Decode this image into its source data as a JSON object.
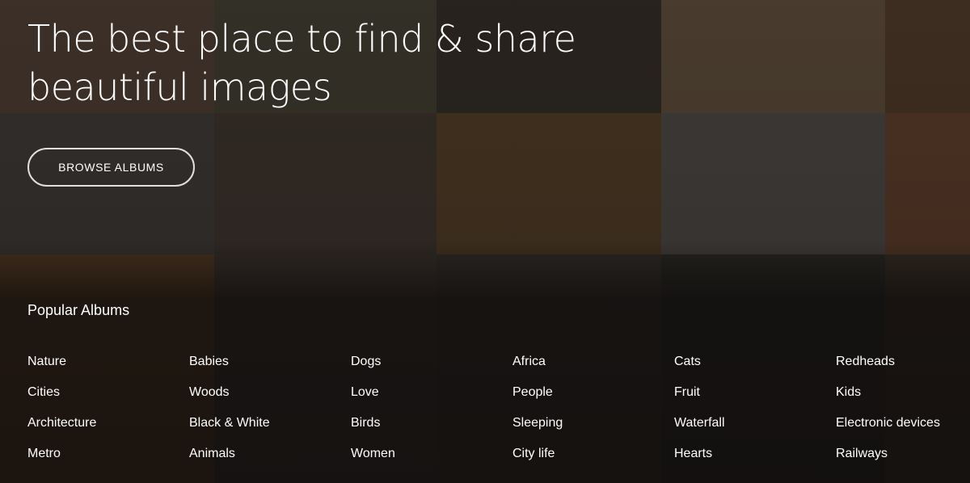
{
  "hero": {
    "headline_line1": "The best place to find & share",
    "headline_line2": "beautiful images",
    "browse_button_label": "BROWSE ALBUMS"
  },
  "popular": {
    "title": "Popular Albums",
    "columns": [
      [
        "Nature",
        "Cities",
        "Architecture",
        "Metro"
      ],
      [
        "Babies",
        "Woods",
        "Black & White",
        "Animals"
      ],
      [
        "Dogs",
        "Love",
        "Birds",
        "Women"
      ],
      [
        "Africa",
        "People",
        "Sleeping",
        "City life"
      ],
      [
        "Cats",
        "Fruit",
        "Waterfall",
        "Hearts"
      ],
      [
        "Redheads",
        "Kids",
        "Electronic devices",
        "Railways"
      ]
    ]
  },
  "colors": {
    "text": "#ffffff",
    "background": "#1a1512"
  }
}
